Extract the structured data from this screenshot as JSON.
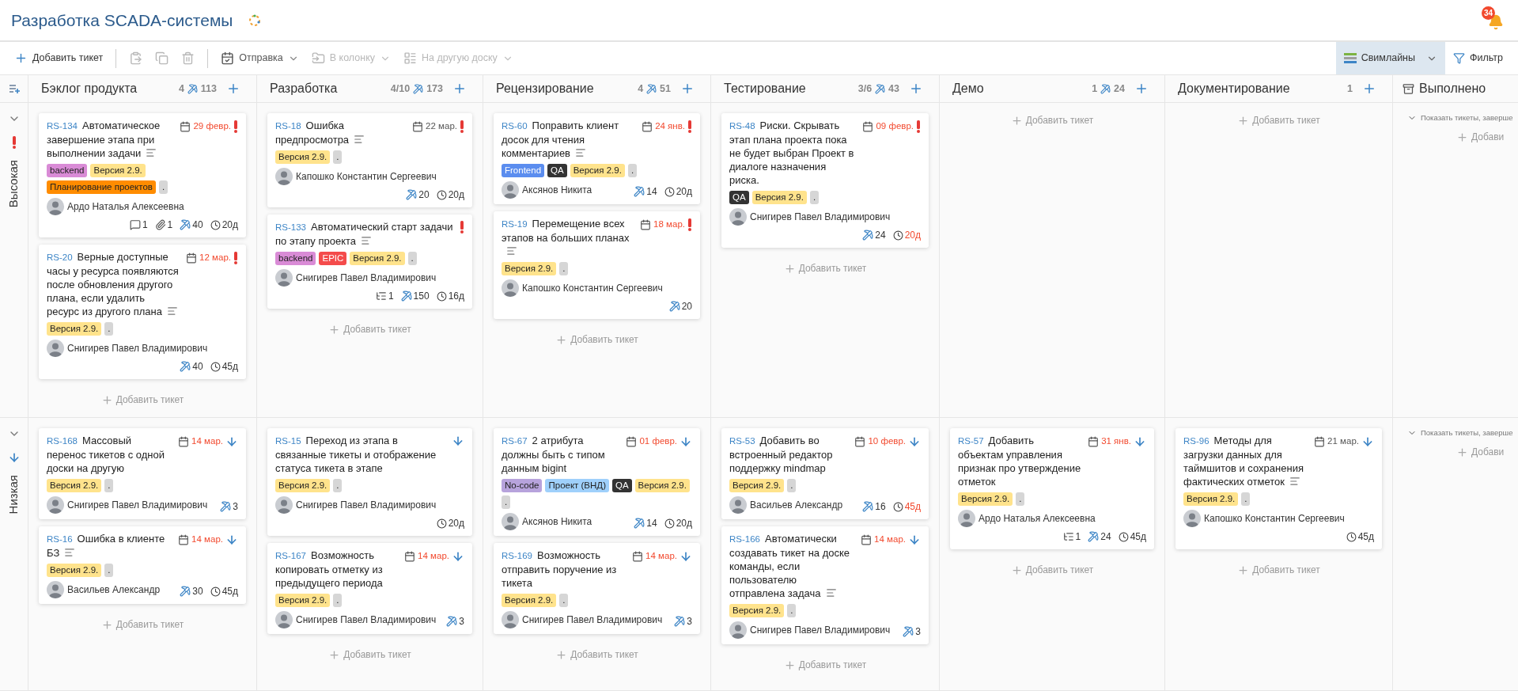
{
  "header": {
    "title": "Разработка SCADA-системы",
    "notifications": "34"
  },
  "toolbar": {
    "items": [
      {
        "kind": "add",
        "label": "Добавить тикет"
      },
      {
        "kind": "paste",
        "disabled": true
      },
      {
        "kind": "copy",
        "disabled": true
      },
      {
        "kind": "delete",
        "disabled": true
      },
      {
        "kind": "send",
        "label": "Отправка",
        "disabled": false
      },
      {
        "kind": "to-column",
        "label": "В колонку",
        "disabled": true
      },
      {
        "kind": "to-board",
        "label": "На другую доску",
        "disabled": true
      }
    ],
    "right": [
      {
        "kind": "swimlanes",
        "label": "Свимлайны",
        "selected": true
      },
      {
        "kind": "filter",
        "label": "Фильтр",
        "selected": false
      }
    ]
  },
  "columns": [
    {
      "kind": "stage",
      "title": "Бэклог продукта",
      "count": "4",
      "points": "113"
    },
    {
      "kind": "stage",
      "title": "Разработка",
      "count": "4/10",
      "points": "173"
    },
    {
      "kind": "stage",
      "title": "Рецензирование",
      "count": "4",
      "points": "51"
    },
    {
      "kind": "stage",
      "title": "Тестирование",
      "count": "3/6",
      "points": "43"
    },
    {
      "kind": "stage",
      "title": "Демо",
      "count": "1",
      "points": "24"
    },
    {
      "kind": "stage",
      "title": "Документирование",
      "count": "1"
    },
    {
      "kind": "archive",
      "title": "Выполнено"
    }
  ],
  "swimlanes": [
    {
      "label": "Высокая",
      "priority": {
        "kind": "high"
      },
      "expanded": true,
      "cells": [
        {
          "kind": "stage",
          "add_label": "Добавить тикет",
          "cards": [
            {
              "id": "RS-134",
              "title": "Автоматическое завершение этапа при выполнении задачи",
              "description": true,
              "due": {
                "text": "29 февр.",
                "overdue": true
              },
              "priority": {
                "kind": "high"
              },
              "tags": [
                {
                  "label": "backend",
                  "color": "#d98bd6"
                },
                {
                  "label": "Версия 2.9.",
                  "color": "#ffe38c"
                },
                {
                  "label": "Планирование проектов",
                  "color": "#ff8c00"
                },
                {
                  "label": ".",
                  "color": "#d6d6d6"
                }
              ],
              "assignee": "Ардо Наталья Алексеевна",
              "stats": [
                {
                  "kind": "comments",
                  "value": "1"
                },
                {
                  "kind": "attachments",
                  "value": "1"
                },
                {
                  "kind": "points",
                  "value": "40"
                },
                {
                  "kind": "age",
                  "value": "20д",
                  "overdue": false
                }
              ]
            },
            {
              "id": "RS-20",
              "title": "Верные доступные часы у ресурса появляются после обновления другого плана, если удалить ресурс из другого плана",
              "description": true,
              "due": {
                "text": "12 мар.",
                "overdue": true
              },
              "priority": {
                "kind": "high"
              },
              "tags": [
                {
                  "label": "Версия 2.9.",
                  "color": "#ffe38c"
                },
                {
                  "label": ".",
                  "color": "#d6d6d6"
                }
              ],
              "assignee": "Снигирев Павел Владимирович",
              "stats": [
                {
                  "kind": "points",
                  "value": "40"
                },
                {
                  "kind": "age",
                  "value": "45д",
                  "overdue": false
                }
              ]
            }
          ]
        },
        {
          "kind": "stage",
          "add_label": "Добавить тикет",
          "cards": [
            {
              "id": "RS-18",
              "title": "Ошибка предпросмотра",
              "description": true,
              "due": {
                "text": "22 мар.",
                "overdue": false
              },
              "priority": {
                "kind": "high"
              },
              "tags": [
                {
                  "label": "Версия 2.9.",
                  "color": "#ffe38c"
                },
                {
                  "label": ".",
                  "color": "#d6d6d6"
                }
              ],
              "assignee": "Капошко Константин Сергеевич",
              "stats": [
                {
                  "kind": "points",
                  "value": "20"
                },
                {
                  "kind": "age",
                  "value": "20д",
                  "overdue": false
                }
              ]
            },
            {
              "id": "RS-133",
              "title": "Автоматический старт задачи по этапу проекта",
              "description": true,
              "priority": {
                "kind": "high"
              },
              "tags": [
                {
                  "label": "backend",
                  "color": "#d98bd6"
                },
                {
                  "label": "EPIC",
                  "color": "#f44b4b"
                },
                {
                  "label": "Версия 2.9.",
                  "color": "#ffe38c"
                },
                {
                  "label": ".",
                  "color": "#d6d6d6"
                }
              ],
              "assignee": "Снигирев Павел Владимирович",
              "stats": [
                {
                  "kind": "subtasks",
                  "value": "1"
                },
                {
                  "kind": "points",
                  "value": "150"
                },
                {
                  "kind": "age",
                  "value": "16д",
                  "overdue": false
                }
              ]
            }
          ]
        },
        {
          "kind": "stage",
          "add_label": "Добавить тикет",
          "cards": [
            {
              "id": "RS-60",
              "title": "Поправить клиент досок для чтения комментариев",
              "description": true,
              "due": {
                "text": "24 янв.",
                "overdue": true
              },
              "priority": {
                "kind": "high"
              },
              "tags": [
                {
                  "label": "Frontend",
                  "color": "#5b8def"
                },
                {
                  "label": "QA",
                  "color": "#333333"
                },
                {
                  "label": "Версия 2.9.",
                  "color": "#ffe38c"
                },
                {
                  "label": ".",
                  "color": "#d6d6d6"
                }
              ],
              "assignee": "Аксянов Никита",
              "stats": [
                {
                  "kind": "points",
                  "value": "14"
                },
                {
                  "kind": "age",
                  "value": "20д",
                  "overdue": false
                }
              ]
            },
            {
              "id": "RS-19",
              "title": "Перемещение всех этапов на больших планах",
              "description": true,
              "due": {
                "text": "18 мар.",
                "overdue": true
              },
              "priority": {
                "kind": "high"
              },
              "tags": [
                {
                  "label": "Версия 2.9.",
                  "color": "#ffe38c"
                },
                {
                  "label": ".",
                  "color": "#d6d6d6"
                }
              ],
              "assignee": "Капошко Константин Сергеевич",
              "stats": [
                {
                  "kind": "points",
                  "value": "20"
                }
              ]
            }
          ]
        },
        {
          "kind": "stage",
          "add_label": "Добавить тикет",
          "cards": [
            {
              "id": "RS-48",
              "title": "Риски. Скрывать этап плана проекта пока не будет выбран Проект в диалоге назначения риска.",
              "description": false,
              "due": {
                "text": "09 февр.",
                "overdue": true
              },
              "priority": {
                "kind": "high"
              },
              "tags": [
                {
                  "label": "QA",
                  "color": "#333333"
                },
                {
                  "label": "Версия 2.9.",
                  "color": "#ffe38c"
                },
                {
                  "label": ".",
                  "color": "#d6d6d6"
                }
              ],
              "assignee": "Снигирев Павел Владимирович",
              "stats": [
                {
                  "kind": "points",
                  "value": "24"
                },
                {
                  "kind": "age",
                  "value": "20д",
                  "overdue": true
                }
              ]
            }
          ]
        },
        {
          "kind": "stage",
          "add_label": "Добавить тикет"
        },
        {
          "kind": "stage",
          "add_label": "Добавить тикет"
        },
        {
          "kind": "done",
          "show_label": "Показать тикеты, заверше",
          "add_label": "Добави"
        }
      ]
    },
    {
      "label": "Низкая",
      "priority": {
        "kind": "low"
      },
      "expanded": true,
      "cells": [
        {
          "kind": "stage",
          "add_label": "Добавить тикет",
          "cards": [
            {
              "id": "RS-168",
              "title": "Массовый перенос тикетов с одной доски на другую",
              "description": false,
              "due": {
                "text": "14 мар.",
                "overdue": true
              },
              "priority": {
                "kind": "low"
              },
              "tags": [
                {
                  "label": "Версия 2.9.",
                  "color": "#ffe38c"
                },
                {
                  "label": ".",
                  "color": "#d6d6d6"
                }
              ],
              "assignee": "Снигирев Павел Владимирович",
              "stats": [
                {
                  "kind": "points",
                  "value": "3"
                }
              ]
            },
            {
              "id": "RS-16",
              "title": "Ошибка в клиенте БЗ",
              "description": true,
              "due": {
                "text": "14 мар.",
                "overdue": true
              },
              "priority": {
                "kind": "low"
              },
              "tags": [
                {
                  "label": "Версия 2.9.",
                  "color": "#ffe38c"
                },
                {
                  "label": ".",
                  "color": "#d6d6d6"
                }
              ],
              "assignee": "Васильев Александр",
              "stats": [
                {
                  "kind": "points",
                  "value": "30"
                },
                {
                  "kind": "age",
                  "value": "45д",
                  "overdue": false
                }
              ]
            }
          ]
        },
        {
          "kind": "stage",
          "add_label": "Добавить тикет",
          "cards": [
            {
              "id": "RS-15",
              "title": "Переход из этапа в связанные тикеты и отображение статуса тикета в этапе",
              "description": false,
              "priority": {
                "kind": "low"
              },
              "tags": [
                {
                  "label": "Версия 2.9.",
                  "color": "#ffe38c"
                },
                {
                  "label": ".",
                  "color": "#d6d6d6"
                }
              ],
              "assignee": "Снигирев Павел Владимирович",
              "stats": [
                {
                  "kind": "age",
                  "value": "20д",
                  "overdue": false
                }
              ]
            },
            {
              "id": "RS-167",
              "title": "Возможность копировать отметку из предыдущего периода",
              "description": false,
              "due": {
                "text": "14 мар.",
                "overdue": true
              },
              "priority": {
                "kind": "low"
              },
              "tags": [
                {
                  "label": "Версия 2.9.",
                  "color": "#ffe38c"
                },
                {
                  "label": ".",
                  "color": "#d6d6d6"
                }
              ],
              "assignee": "Снигирев Павел Владимирович",
              "stats": [
                {
                  "kind": "points",
                  "value": "3"
                }
              ]
            }
          ]
        },
        {
          "kind": "stage",
          "add_label": "Добавить тикет",
          "cards": [
            {
              "id": "RS-67",
              "title": "2 атрибута должны быть с типом данным bigint",
              "description": false,
              "due": {
                "text": "01 февр.",
                "overdue": true
              },
              "priority": {
                "kind": "low"
              },
              "tags": [
                {
                  "label": "No-code",
                  "color": "#b7a3dc"
                },
                {
                  "label": "Проект (ВНД)",
                  "color": "#9fd0fb"
                },
                {
                  "label": "QA",
                  "color": "#333333"
                },
                {
                  "label": "Версия 2.9.",
                  "color": "#ffe38c"
                },
                {
                  "label": ".",
                  "color": "#d6d6d6"
                }
              ],
              "assignee": "Аксянов Никита",
              "stats": [
                {
                  "kind": "points",
                  "value": "14"
                },
                {
                  "kind": "age",
                  "value": "20д",
                  "overdue": false
                }
              ]
            },
            {
              "id": "RS-169",
              "title": "Возможность отправить поручение из тикета",
              "description": false,
              "due": {
                "text": "14 мар.",
                "overdue": true
              },
              "priority": {
                "kind": "low"
              },
              "tags": [
                {
                  "label": "Версия 2.9.",
                  "color": "#ffe38c"
                },
                {
                  "label": ".",
                  "color": "#d6d6d6"
                }
              ],
              "assignee": "Снигирев Павел Владимирович",
              "stats": [
                {
                  "kind": "points",
                  "value": "3"
                }
              ]
            }
          ]
        },
        {
          "kind": "stage",
          "add_label": "Добавить тикет",
          "cards": [
            {
              "id": "RS-53",
              "title": "Добавить во встроенный редактор поддержку mindmap",
              "description": false,
              "due": {
                "text": "10 февр.",
                "overdue": true
              },
              "priority": {
                "kind": "low"
              },
              "tags": [
                {
                  "label": "Версия 2.9.",
                  "color": "#ffe38c"
                },
                {
                  "label": ".",
                  "color": "#d6d6d6"
                }
              ],
              "assignee": "Васильев Александр",
              "stats": [
                {
                  "kind": "points",
                  "value": "16"
                },
                {
                  "kind": "age",
                  "value": "45д",
                  "overdue": true
                }
              ]
            },
            {
              "id": "RS-166",
              "title": "Автоматически создавать тикет на доске команды, если пользователю отправлена задача",
              "description": true,
              "due": {
                "text": "14 мар.",
                "overdue": true
              },
              "priority": {
                "kind": "low"
              },
              "tags": [
                {
                  "label": "Версия 2.9.",
                  "color": "#ffe38c"
                },
                {
                  "label": ".",
                  "color": "#d6d6d6"
                }
              ],
              "assignee": "Снигирев Павел Владимирович",
              "stats": [
                {
                  "kind": "points",
                  "value": "3"
                }
              ]
            }
          ]
        },
        {
          "kind": "stage",
          "add_label": "Добавить тикет",
          "cards": [
            {
              "id": "RS-57",
              "title": "Добавить объектам управления признак про утверждение отметок",
              "description": false,
              "due": {
                "text": "31 янв.",
                "overdue": true
              },
              "priority": {
                "kind": "low"
              },
              "tags": [
                {
                  "label": "Версия 2.9.",
                  "color": "#ffe38c"
                },
                {
                  "label": ".",
                  "color": "#d6d6d6"
                }
              ],
              "assignee": "Ардо Наталья Алексеевна",
              "stats": [
                {
                  "kind": "subtasks",
                  "value": "1"
                },
                {
                  "kind": "points",
                  "value": "24"
                },
                {
                  "kind": "age",
                  "value": "45д",
                  "overdue": false
                }
              ]
            }
          ]
        },
        {
          "kind": "stage",
          "add_label": "Добавить тикет",
          "cards": [
            {
              "id": "RS-96",
              "title": "Методы для загрузки данных для таймшитов и сохранения фактических отметок",
              "description": true,
              "due": {
                "text": "21 мар.",
                "overdue": false
              },
              "priority": {
                "kind": "low"
              },
              "tags": [
                {
                  "label": "Версия 2.9.",
                  "color": "#ffe38c"
                },
                {
                  "label": ".",
                  "color": "#d6d6d6"
                }
              ],
              "assignee": "Капошко Константин Сергеевич",
              "stats": [
                {
                  "kind": "age",
                  "value": "45д",
                  "overdue": false
                }
              ]
            }
          ]
        },
        {
          "kind": "done",
          "show_label": "Показать тикеты, заверше",
          "add_label": "Добави"
        }
      ]
    }
  ]
}
